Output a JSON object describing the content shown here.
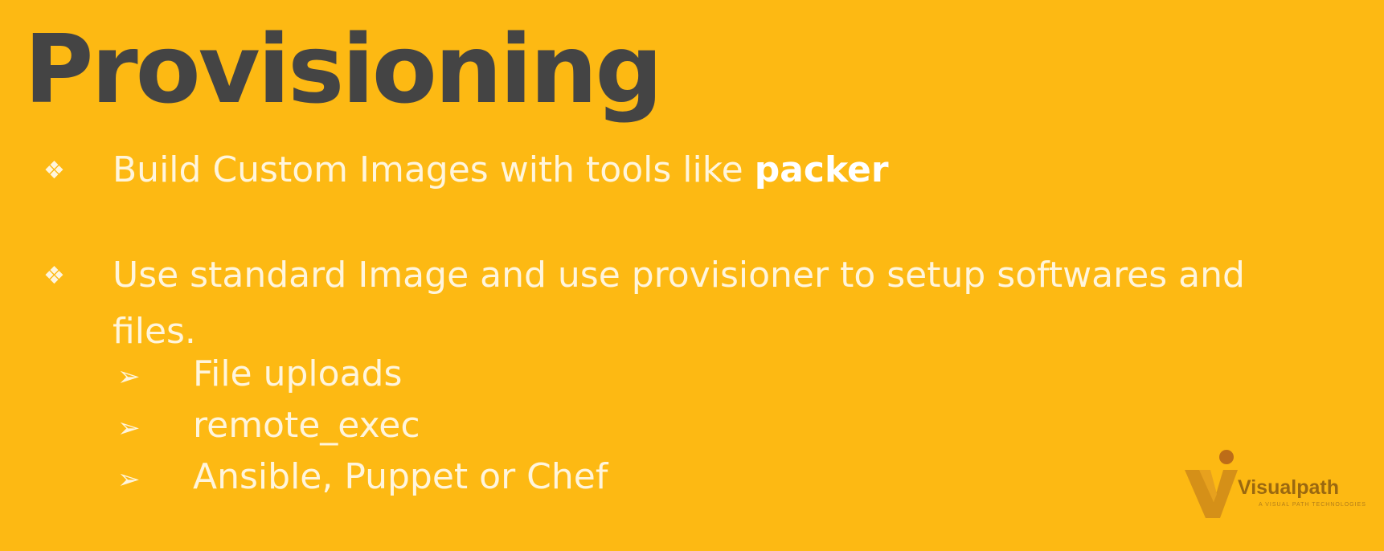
{
  "slide": {
    "title": "Provisioning",
    "bullets": [
      {
        "marker": "❖",
        "text_before": "Build Custom Images with tools like ",
        "text_bold": "packer"
      },
      {
        "marker": "❖",
        "text": "Use standard Image and use provisioner to setup softwares and files."
      }
    ],
    "sub_items": [
      {
        "marker": "➢",
        "text": "File uploads"
      },
      {
        "marker": "➢",
        "text": "remote_exec"
      },
      {
        "marker": "➢",
        "text": "Ansible, Puppet or Chef"
      }
    ]
  },
  "logo": {
    "name": "Visualpath",
    "tagline": "A VISUAL PATH TECHNOLOGIES"
  },
  "colors": {
    "background": "#FDB913",
    "title": "#444444",
    "text": "#FFF5DC"
  }
}
